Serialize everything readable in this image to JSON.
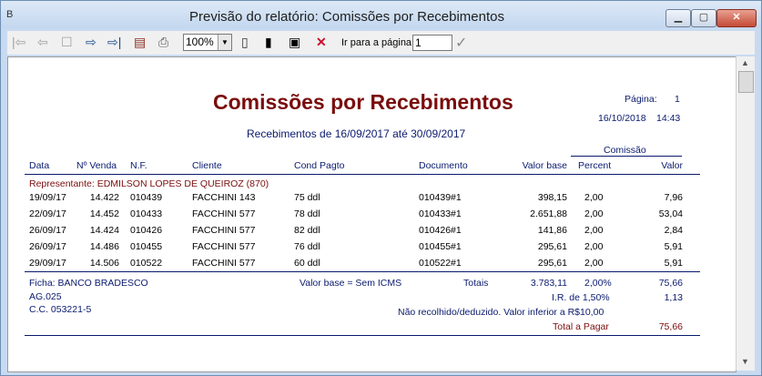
{
  "window": {
    "title": "Previsão do relatório: Comissões por Recebimentos",
    "min_label": "▁",
    "max_label": "▢",
    "close_label": "✕",
    "app_icon": "B"
  },
  "toolbar": {
    "zoom": "100%",
    "goto_label": "Ir para a página",
    "page_value": "1",
    "icons": [
      "first-page-icon",
      "prev-page-icon",
      "stop-icon",
      "next-page-icon",
      "last-page-icon",
      "export-icon",
      "print-icon",
      "page-icon",
      "page-width-icon",
      "full-page-icon",
      "close-preview-icon",
      "confirm-icon"
    ]
  },
  "report": {
    "title": "Comissões por Recebimentos",
    "page_label": "Página:",
    "page_number": "1",
    "date": "16/10/2018",
    "time": "14:43",
    "period": "Recebimentos de 16/09/2017 até 30/09/2017",
    "commission_group": "Comissão",
    "columns": [
      "Data",
      "Nº Venda",
      "N.F.",
      "Cliente",
      "Cond Pagto",
      "Documento",
      "Valor base",
      "Percent",
      "Valor"
    ],
    "representative": "Representante: EDMILSON LOPES DE QUEIROZ (870)",
    "rows": [
      [
        "19/09/17",
        "14.422",
        "010439",
        "FACCHINI 143",
        "75 ddl",
        "010439#1",
        "398,15",
        "2,00",
        "7,96"
      ],
      [
        "22/09/17",
        "14.452",
        "010433",
        "FACCHINI 577",
        "78 ddl",
        "010433#1",
        "2.651,88",
        "2,00",
        "53,04"
      ],
      [
        "26/09/17",
        "14.424",
        "010426",
        "FACCHINI 577",
        "82 ddl",
        "010426#1",
        "141,86",
        "2,00",
        "2,84"
      ],
      [
        "26/09/17",
        "14.486",
        "010455",
        "FACCHINI 577",
        "76 ddl",
        "010455#1",
        "295,61",
        "2,00",
        "5,91"
      ],
      [
        "29/09/17",
        "14.506",
        "010522",
        "FACCHINI 577",
        "60 ddl",
        "010522#1",
        "295,61",
        "2,00",
        "5,91"
      ]
    ],
    "footer": {
      "ficha": "Ficha: BANCO BRADESCO",
      "ag": "AG.025",
      "cc": "C.C. 053221-5",
      "base_note": "Valor base = Sem ICMS",
      "totals_label": "Totais",
      "totals_base": "3.783,11",
      "totals_percent": "2,00%",
      "totals_value": "75,66",
      "ir_label": "I.R. de 1,50%",
      "ir_value": "1,13",
      "note": "Não recolhido/deduzido. Valor inferior a R$10,00",
      "pay_label": "Total a Pagar",
      "pay_value": "75,66"
    }
  }
}
